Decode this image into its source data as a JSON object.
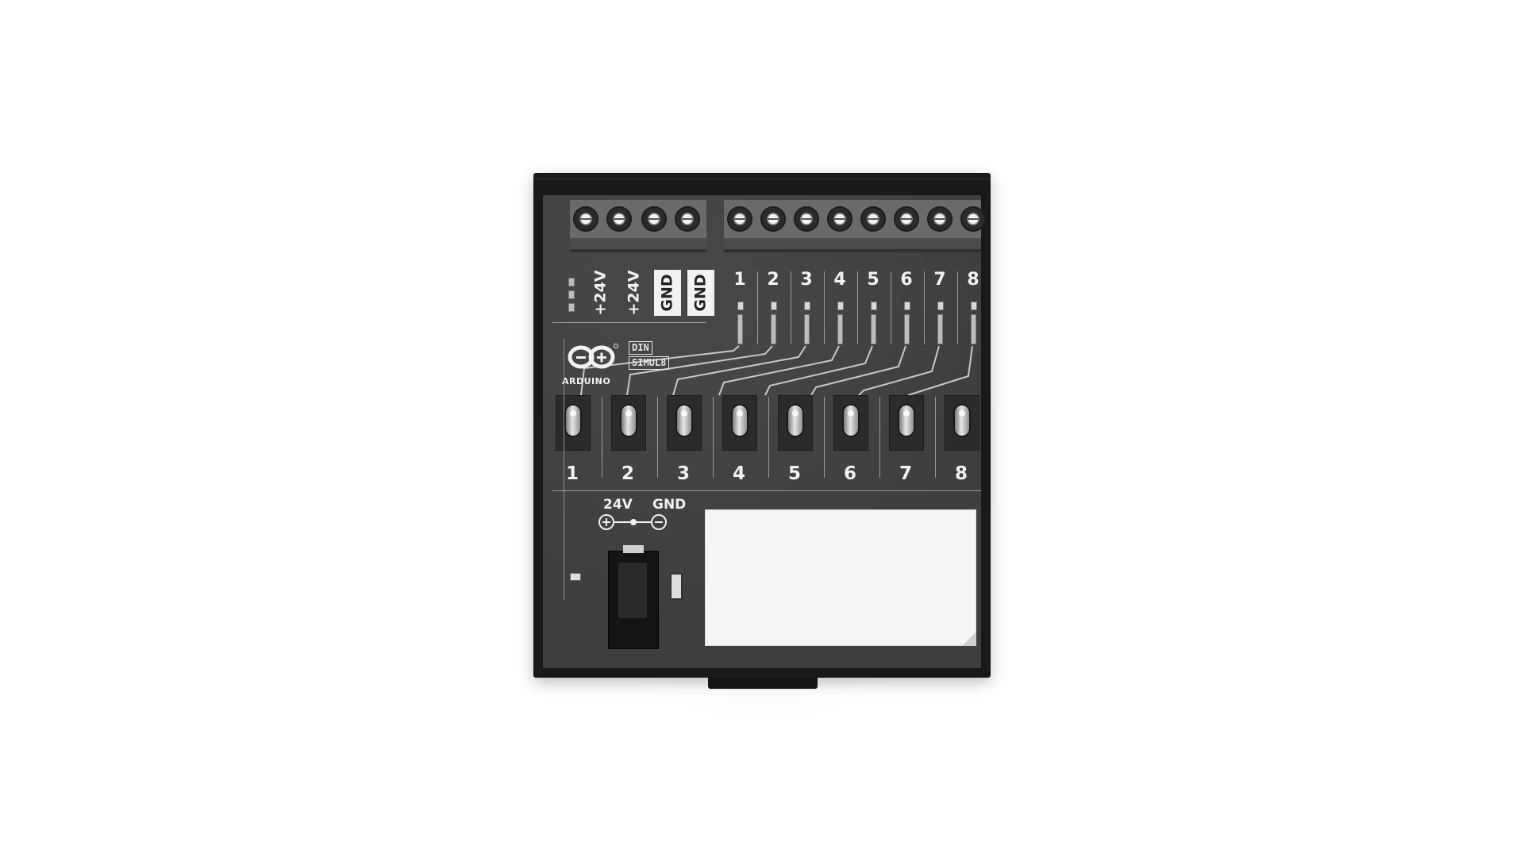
{
  "product": {
    "brand": "ARDUINO",
    "model_line1": "DIN",
    "model_line2": "SIMUL8"
  },
  "power_terminals": [
    "+24V",
    "+24V",
    "GND",
    "GND"
  ],
  "channel_terminals": [
    "1",
    "2",
    "3",
    "4",
    "5",
    "6",
    "7",
    "8"
  ],
  "switches": [
    "1",
    "2",
    "3",
    "4",
    "5",
    "6",
    "7",
    "8"
  ],
  "power_input": {
    "voltage_label": "24V",
    "ground_label": "GND"
  },
  "colors": {
    "enclosure": "#191919",
    "board": "#414141",
    "print": "#f2f2f2",
    "label_area": "#f5f5f5"
  },
  "icons": [
    "arduino-logo-icon",
    "screw-terminal-icon",
    "toggle-switch-icon",
    "dc-jack-icon",
    "polarity-symbol-icon"
  ]
}
